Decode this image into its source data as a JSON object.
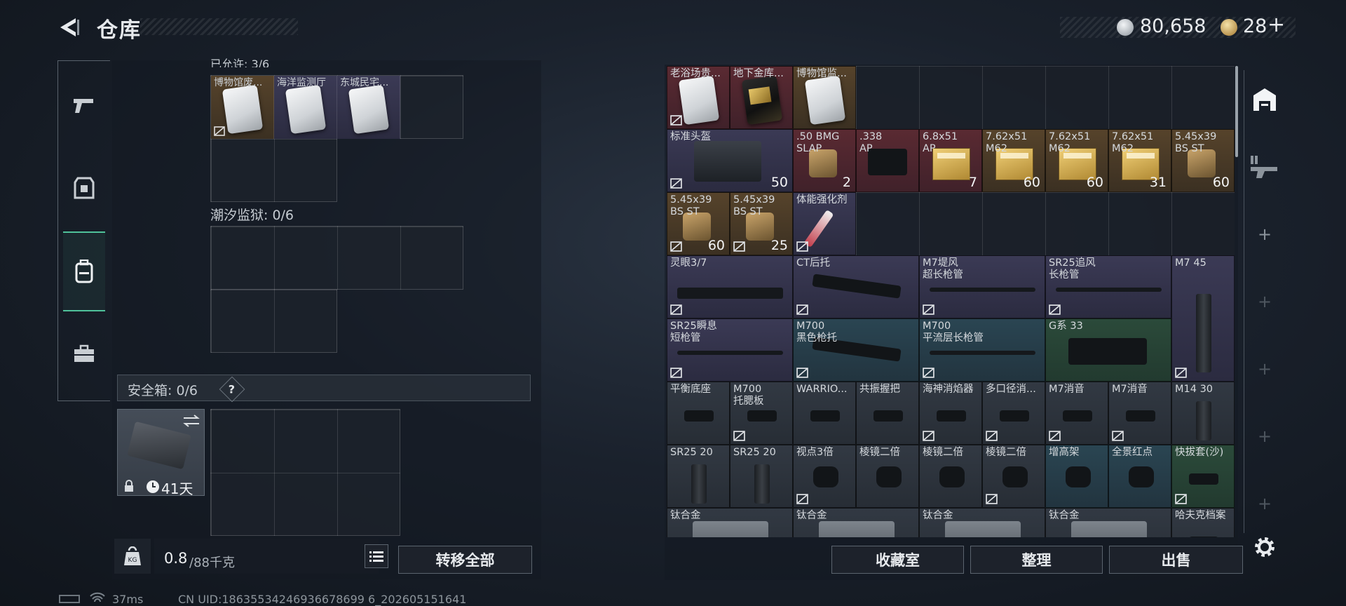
{
  "header": {
    "title": "仓库",
    "currency_silver": "80,658",
    "currency_gold": "28",
    "plus_glyph": "+"
  },
  "left": {
    "section_top_label": "已允许: 3/6",
    "section_top_slots": [
      "博物馆废...",
      "海洋监测厅",
      "东城民宅..."
    ],
    "section_prison_label": "潮汐监狱: 0/6",
    "safe_box_label": "安全箱: 0/6",
    "safe_box_help": "?",
    "safe_box_days": "41天",
    "weight_value": "0.8",
    "weight_max": "/88千克",
    "transfer_all": "转移全部"
  },
  "right": {
    "items": [
      {
        "label": "老浴场贵...",
        "bg": "red"
      },
      {
        "label": "地下金库...",
        "bg": "red"
      },
      {
        "label": "博物馆监...",
        "bg": "gold"
      },
      {
        "label": "标准头盔",
        "bg": "purple",
        "count": "50"
      },
      {
        "label": ".50 BMG\nSLAP",
        "bg": "red",
        "count": "2"
      },
      {
        "label": ".338\nAP",
        "bg": "red"
      },
      {
        "label": "6.8x51\nAP",
        "bg": "red",
        "count": "7"
      },
      {
        "label": "7.62x51\nM62",
        "bg": "gold",
        "count": "60"
      },
      {
        "label": "7.62x51\nM62",
        "bg": "gold",
        "count": "60"
      },
      {
        "label": "7.62x51\nM62",
        "bg": "gold",
        "count": "31"
      },
      {
        "label": "5.45x39\nBS ST",
        "bg": "gold",
        "count": "60"
      },
      {
        "label": "5.45x39\nBS ST",
        "bg": "gold",
        "count": "60"
      },
      {
        "label": "5.45x39\nBS ST",
        "bg": "gold",
        "count": "25"
      },
      {
        "label": "体能强化剂",
        "bg": "purple"
      },
      {
        "label": "灵眼3/7",
        "bg": "purple"
      },
      {
        "label": "CT后托",
        "bg": "purple"
      },
      {
        "label": "M7堤风\n超长枪管",
        "bg": "purple"
      },
      {
        "label": "SR25追风\n长枪管",
        "bg": "purple"
      },
      {
        "label": "M7 45",
        "bg": "purple"
      },
      {
        "label": "SR25瞬息\n短枪管",
        "bg": "purple"
      },
      {
        "label": "M700\n黑色枪托",
        "bg": "blue"
      },
      {
        "label": "M700\n平流层长枪管",
        "bg": "blue"
      },
      {
        "label": "G系 33",
        "bg": "green"
      },
      {
        "label": "平衡底座",
        "bg": "grey"
      },
      {
        "label": "M700\n托腮板",
        "bg": "grey"
      },
      {
        "label": "WARRIO...",
        "bg": "grey"
      },
      {
        "label": "共振握把",
        "bg": "grey"
      },
      {
        "label": "海神消焰器",
        "bg": "grey"
      },
      {
        "label": "多口径消...",
        "bg": "grey"
      },
      {
        "label": "M7消音",
        "bg": "grey"
      },
      {
        "label": "M7消音",
        "bg": "grey"
      },
      {
        "label": "M14 30",
        "bg": "grey"
      },
      {
        "label": "SR25 20",
        "bg": "grey"
      },
      {
        "label": "SR25 20",
        "bg": "grey"
      },
      {
        "label": "视点3倍",
        "bg": "grey"
      },
      {
        "label": "棱镜二倍",
        "bg": "grey"
      },
      {
        "label": "棱镜二倍",
        "bg": "grey"
      },
      {
        "label": "棱镜二倍",
        "bg": "grey"
      },
      {
        "label": "增高架",
        "bg": "blue"
      },
      {
        "label": "全景红点",
        "bg": "blue"
      },
      {
        "label": "快拔套(沙)",
        "bg": "green"
      },
      {
        "label": "钛合金",
        "bg": "grey"
      },
      {
        "label": "钛合金",
        "bg": "grey"
      },
      {
        "label": "钛合金",
        "bg": "grey"
      },
      {
        "label": "钛合金",
        "bg": "grey"
      },
      {
        "label": "哈夫克档案",
        "bg": "grey"
      }
    ],
    "btn_collection": "收藏室",
    "btn_sort": "整理",
    "btn_sell": "出售"
  },
  "footer": {
    "ping": "37ms",
    "uid": "CN UID:18635534246936678699 6_202605151641"
  },
  "colors": {
    "accent": "#4fc29a",
    "rarity_red": "#5a2a32",
    "rarity_gold": "#56432b",
    "rarity_purple": "#3b3a55",
    "rarity_blue": "#2a4552",
    "rarity_green": "#2b4a3a"
  }
}
